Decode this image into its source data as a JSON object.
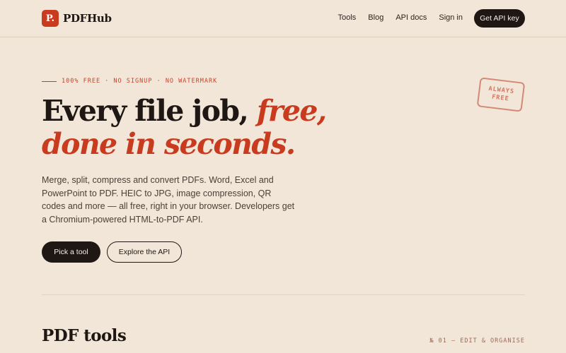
{
  "nav": {
    "logo_mark": "P.",
    "logo_text": "PDFHub",
    "links": [
      "Tools",
      "Blog",
      "API docs",
      "Sign in"
    ],
    "cta": "Get API key"
  },
  "hero": {
    "eyebrow": "100% FREE · NO SIGNUP · NO WATERMARK",
    "headline_part1": "Every file job, ",
    "headline_accent1": "free,",
    "headline_accent2": "done in seconds.",
    "lede": "Merge, split, compress and convert PDFs. Word, Excel and PowerPoint to PDF. HEIC to JPG, image compression, QR codes and more — all free, right in your browser. Developers get a Chromium-powered HTML-to-PDF API.",
    "primary_button": "Pick a tool",
    "secondary_button": "Explore the API",
    "stamp_line1": "ALWAYS",
    "stamp_line2": "FREE"
  },
  "section": {
    "title": "PDF tools",
    "meta": "№ 01 — EDIT & ORGANISE"
  },
  "colors": {
    "background": "#f1e6d8",
    "ink": "#1e1713",
    "accent": "#c83b1f"
  }
}
